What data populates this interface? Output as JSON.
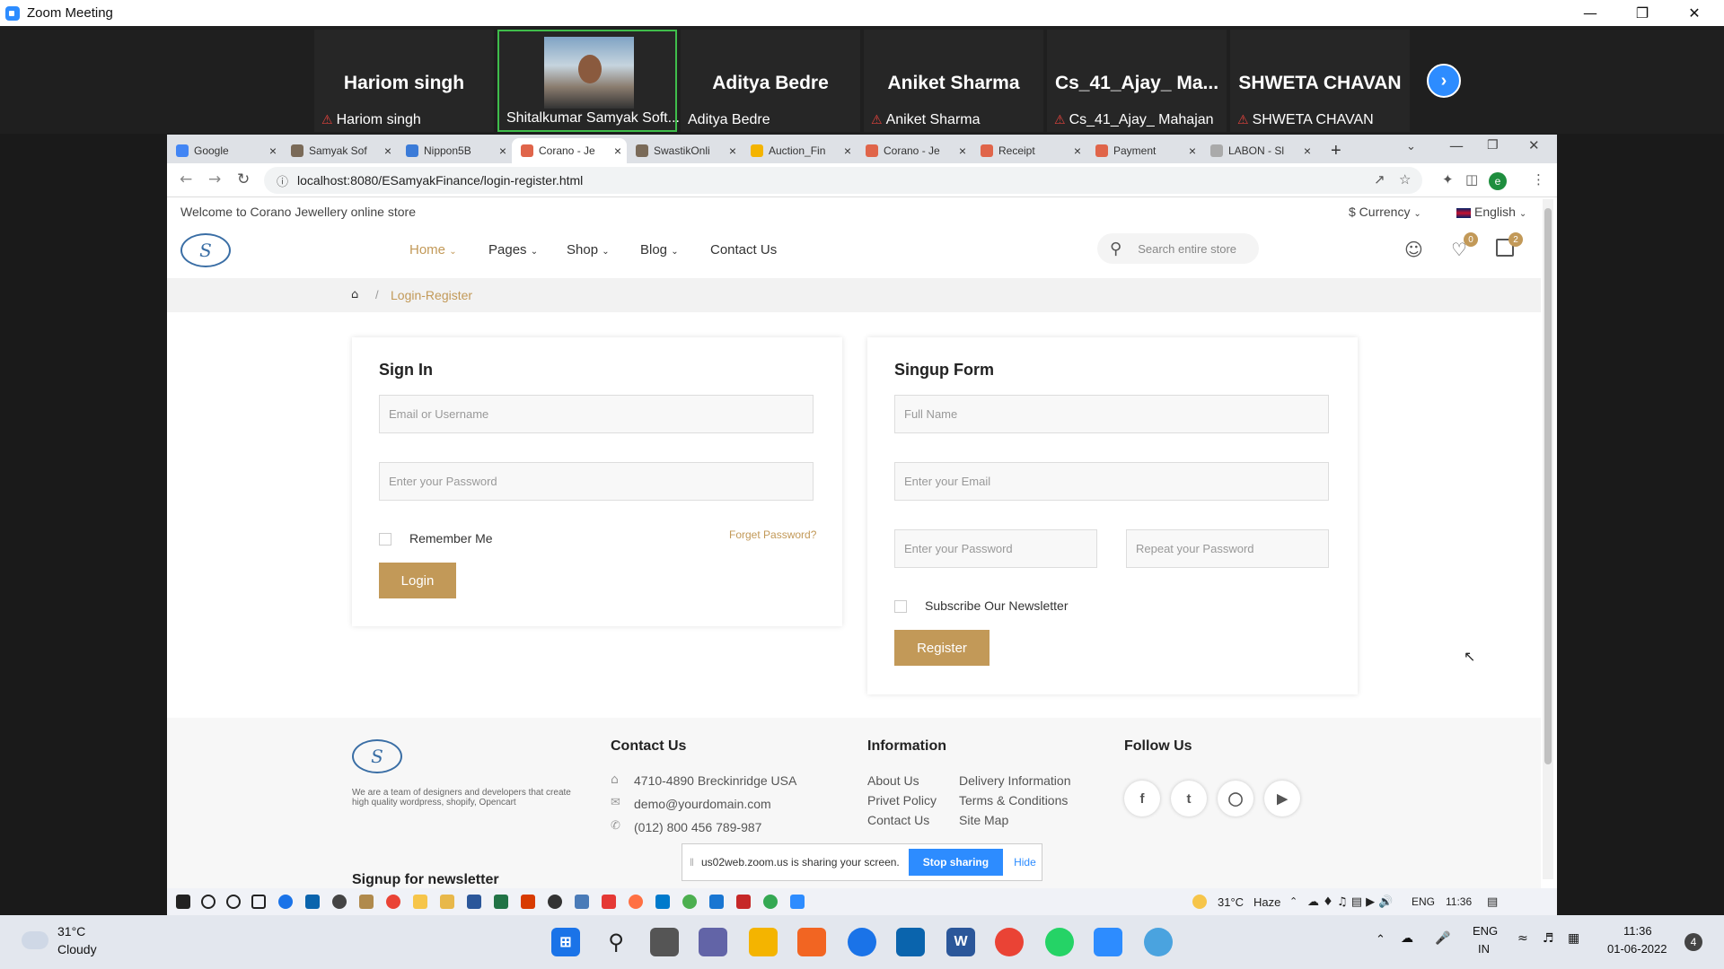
{
  "zoom": {
    "title": "Zoom Meeting",
    "participants": [
      {
        "big": "Hariom singh",
        "small": "Hariom singh",
        "muted": true
      },
      {
        "big": "",
        "small": "Shitalkumar Samyak Soft...",
        "muted": false
      },
      {
        "big": "Aditya Bedre",
        "small": "Aditya Bedre",
        "muted": false
      },
      {
        "big": "Aniket Sharma",
        "small": "Aniket Sharma",
        "muted": true
      },
      {
        "big": "Cs_41_Ajay_ Ma...",
        "small": "Cs_41_Ajay_ Mahajan",
        "muted": true
      },
      {
        "big": "SHWETA CHAVAN",
        "small": "SHWETA CHAVAN",
        "muted": true
      }
    ]
  },
  "browser": {
    "tabs": [
      {
        "label": "Google",
        "color": "#4285f4"
      },
      {
        "label": "Samyak Sof",
        "color": "#7a6a58"
      },
      {
        "label": "Nippon5B",
        "color": "#3b7bd8"
      },
      {
        "label": "Corano - Je",
        "color": "#e0654a"
      },
      {
        "label": "SwastikOnli",
        "color": "#7a6a58"
      },
      {
        "label": "Auction_Fin",
        "color": "#f4b400"
      },
      {
        "label": "Corano - Je",
        "color": "#e0654a"
      },
      {
        "label": "Receipt",
        "color": "#e0654a"
      },
      {
        "label": "Payment",
        "color": "#e0654a"
      },
      {
        "label": "LABON - Sl",
        "color": "#aaaaaa"
      }
    ],
    "new_tab": "+",
    "url": "localhost:8080/ESamyakFinance/login-register.html",
    "profile_initial": "e"
  },
  "site": {
    "welcome": "Welcome to Corano Jewellery online store",
    "currency": "$ Currency",
    "language": "English",
    "menu": [
      "Home",
      "Pages",
      "Shop",
      "Blog",
      "Contact Us"
    ],
    "search_placeholder": "Search entire store",
    "wishlist_count": "0",
    "cart_count": "2",
    "breadcrumb": "Login-Register",
    "signin": {
      "title": "Sign In",
      "email_ph": "Email or Username",
      "password_ph": "Enter your Password",
      "remember": "Remember Me",
      "forgot": "Forget Password?",
      "login": "Login"
    },
    "signup": {
      "title": "Singup Form",
      "name_ph": "Full Name",
      "email_ph": "Enter your Email",
      "password_ph": "Enter your Password",
      "repeat_ph": "Repeat your Password",
      "newsletter": "Subscribe Our Newsletter",
      "register": "Register"
    },
    "footer": {
      "about": "We are a team of designers and developers that create high quality wordpress, shopify, Opencart",
      "newsletter_heading": "Signup for newsletter",
      "contact_heading": "Contact Us",
      "address": "4710-4890 Breckinridge USA",
      "email": "demo@yourdomain.com",
      "phone": "(012) 800 456 789-987",
      "info_heading": "Information",
      "info_col1": [
        "About Us",
        "Privet Policy",
        "Contact Us"
      ],
      "info_col2": [
        "Delivery Information",
        "Terms & Conditions",
        "Site Map"
      ],
      "follow_heading": "Follow Us"
    }
  },
  "sharebar": {
    "text": "us02web.zoom.us is sharing your screen.",
    "stop": "Stop sharing",
    "hide": "Hide"
  },
  "inner_taskbar": {
    "weather": "31°C",
    "condition": "Haze",
    "lang": "ENG",
    "time": "11:36"
  },
  "outer_taskbar": {
    "temp": "31°C",
    "condition": "Cloudy",
    "lang1": "ENG",
    "lang2": "IN",
    "time": "11:36",
    "date": "01-06-2022",
    "notifications": "4"
  }
}
